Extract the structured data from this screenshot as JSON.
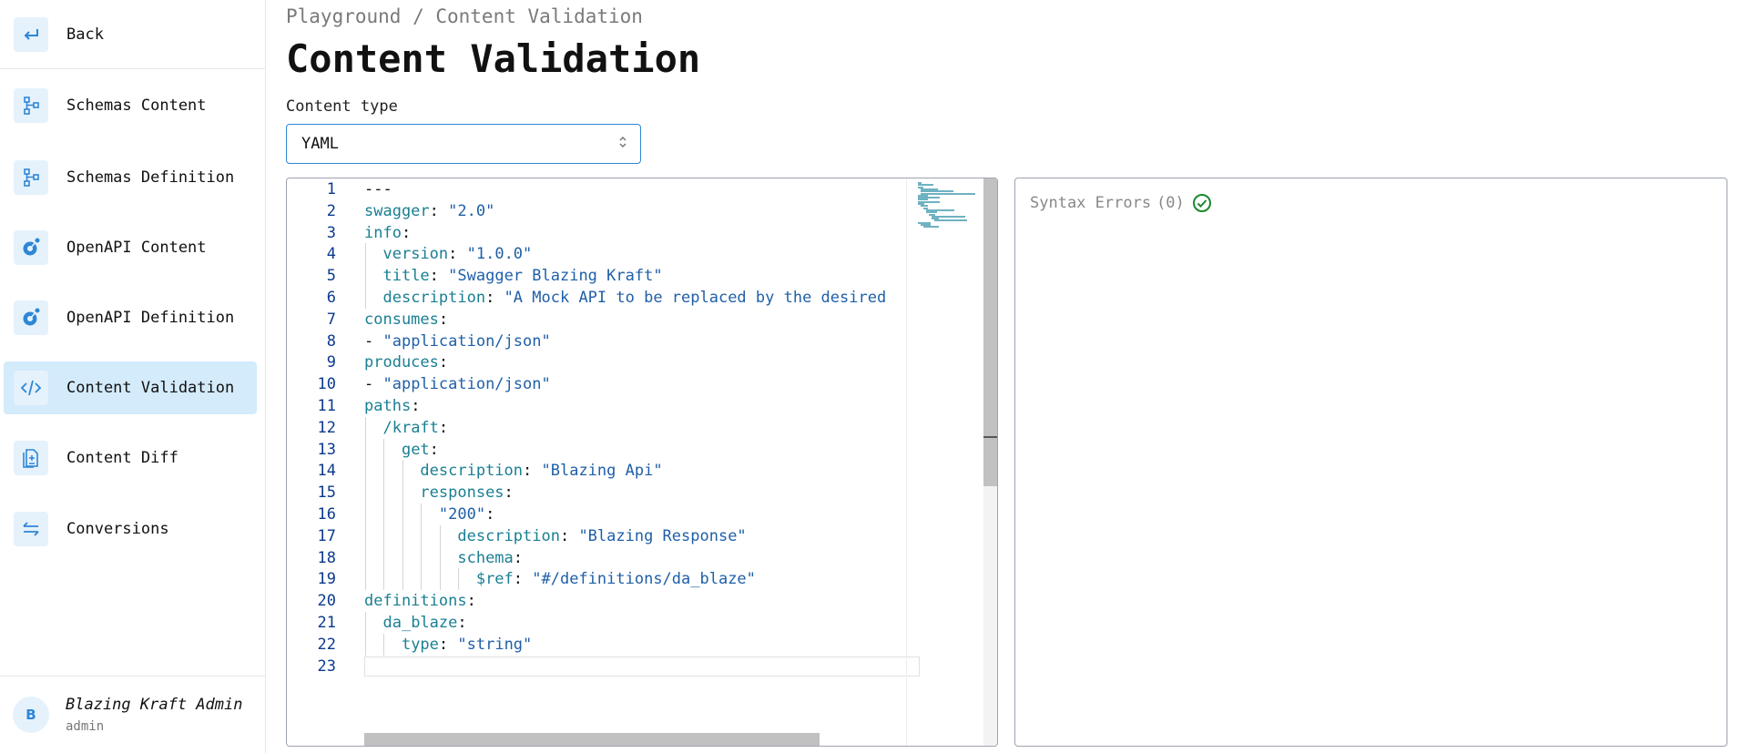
{
  "sidebar": {
    "back_label": "Back",
    "items": [
      {
        "label": "Schemas Content",
        "icon": "schema-tree-icon"
      },
      {
        "label": "Schemas Definition",
        "icon": "schema-tree-icon"
      },
      {
        "label": "OpenAPI Content",
        "icon": "openapi-icon"
      },
      {
        "label": "OpenAPI Definition",
        "icon": "openapi-icon"
      },
      {
        "label": "Content Validation",
        "icon": "code-icon",
        "active": true
      },
      {
        "label": "Content Diff",
        "icon": "diff-icon"
      },
      {
        "label": "Conversions",
        "icon": "arrows-swap-icon"
      }
    ],
    "user": {
      "initial": "B",
      "name": "Blazing Kraft Admin",
      "role": "admin"
    }
  },
  "header": {
    "breadcrumb": "Playground / Content Validation",
    "title": "Content Validation"
  },
  "content_type": {
    "label": "Content type",
    "value": "YAML"
  },
  "editor": {
    "lines": [
      "---",
      "swagger: \"2.0\"",
      "info:",
      "  version: \"1.0.0\"",
      "  title: \"Swagger Blazing Kraft\"",
      "  description: \"A Mock API to be replaced by the desired",
      "consumes:",
      "- \"application/json\"",
      "produces:",
      "- \"application/json\"",
      "paths:",
      "  /kraft:",
      "    get:",
      "      description: \"Blazing Api\"",
      "      responses:",
      "        \"200\":",
      "          description: \"Blazing Response\"",
      "          schema:",
      "            $ref: \"#/definitions/da_blaze\"",
      "definitions:",
      "  da_blaze:",
      "    type: \"string\"",
      ""
    ],
    "line_numbers": [
      "1",
      "2",
      "3",
      "4",
      "5",
      "6",
      "7",
      "8",
      "9",
      "10",
      "11",
      "12",
      "13",
      "14",
      "15",
      "16",
      "17",
      "18",
      "19",
      "20",
      "21",
      "22",
      "23"
    ]
  },
  "errors": {
    "label": "Syntax Errors",
    "count": "(0)",
    "status_icon": "check-circle-icon",
    "status_color": "#1a8a2e"
  },
  "colors": {
    "accent": "#2f86d5",
    "active_bg": "#d3ebfb"
  }
}
